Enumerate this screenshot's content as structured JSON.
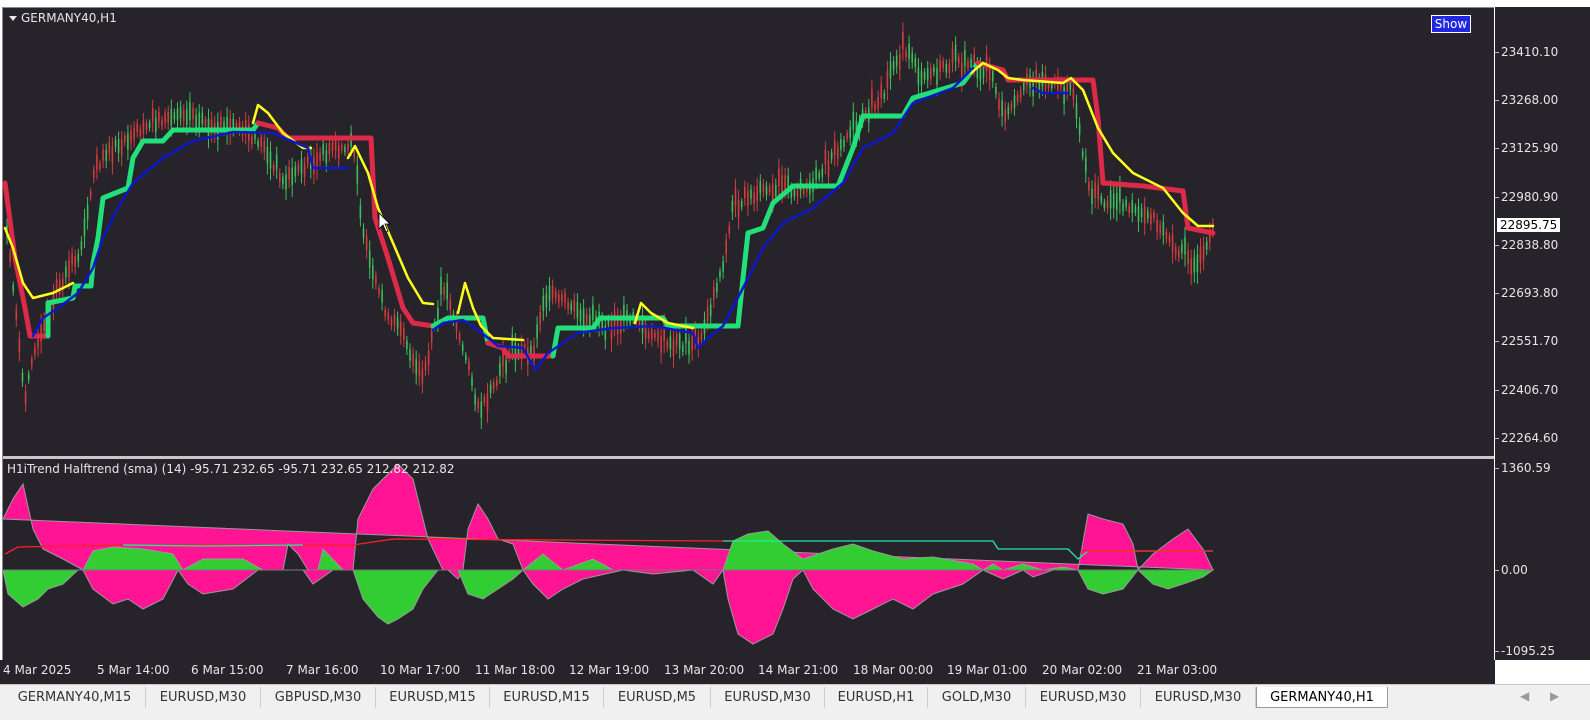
{
  "chart": {
    "title": "GERMANY40,H1",
    "show_button": "Show",
    "current_price": "22895.75",
    "indicator_title": "H1iTrend Halftrend (sma) (14) -95.71 232.65 -95.71 232.65 212.82 212.82"
  },
  "price_axis": [
    "23410.10",
    "23268.00",
    "23125.90",
    "22980.90",
    "22838.80",
    "22693.80",
    "22551.70",
    "22406.70",
    "22264.60"
  ],
  "indicator_axis": [
    "1360.59",
    "0.00",
    "-1095.25"
  ],
  "time_axis": [
    "4 Mar 2025",
    "5 Mar 14:00",
    "6 Mar 15:00",
    "7 Mar 16:00",
    "10 Mar 17:00",
    "11 Mar 18:00",
    "12 Mar 19:00",
    "13 Mar 20:00",
    "14 Mar 21:00",
    "18 Mar 00:00",
    "19 Mar 01:00",
    "20 Mar 02:00",
    "21 Mar 03:00"
  ],
  "tabs": [
    "GERMANY40,M15",
    "EURUSD,M30",
    "GBPUSD,M30",
    "EURUSD,M15",
    "EURUSD,M15",
    "EURUSD,M5",
    "EURUSD,M30",
    "EURUSD,H1",
    "GOLD,M30",
    "EURUSD,M30",
    "EURUSD,M30",
    "GERMANY40,H1"
  ],
  "active_tab": "GERMANY40,H1",
  "colors": {
    "background": "#26232b",
    "up_candle": "#3cbf5a",
    "down_candle": "#d23c3c",
    "halftrend_up": "#21e07a",
    "halftrend_down": "#dc2a48",
    "fast_line": "#ffff1e",
    "slow_line": "#0d18c8",
    "hist_pink": "#ff1493",
    "hist_green": "#32cd32",
    "signal_red": "#ff2020",
    "signal_green": "#22e8a0",
    "show_button": "#1f28e0"
  }
}
